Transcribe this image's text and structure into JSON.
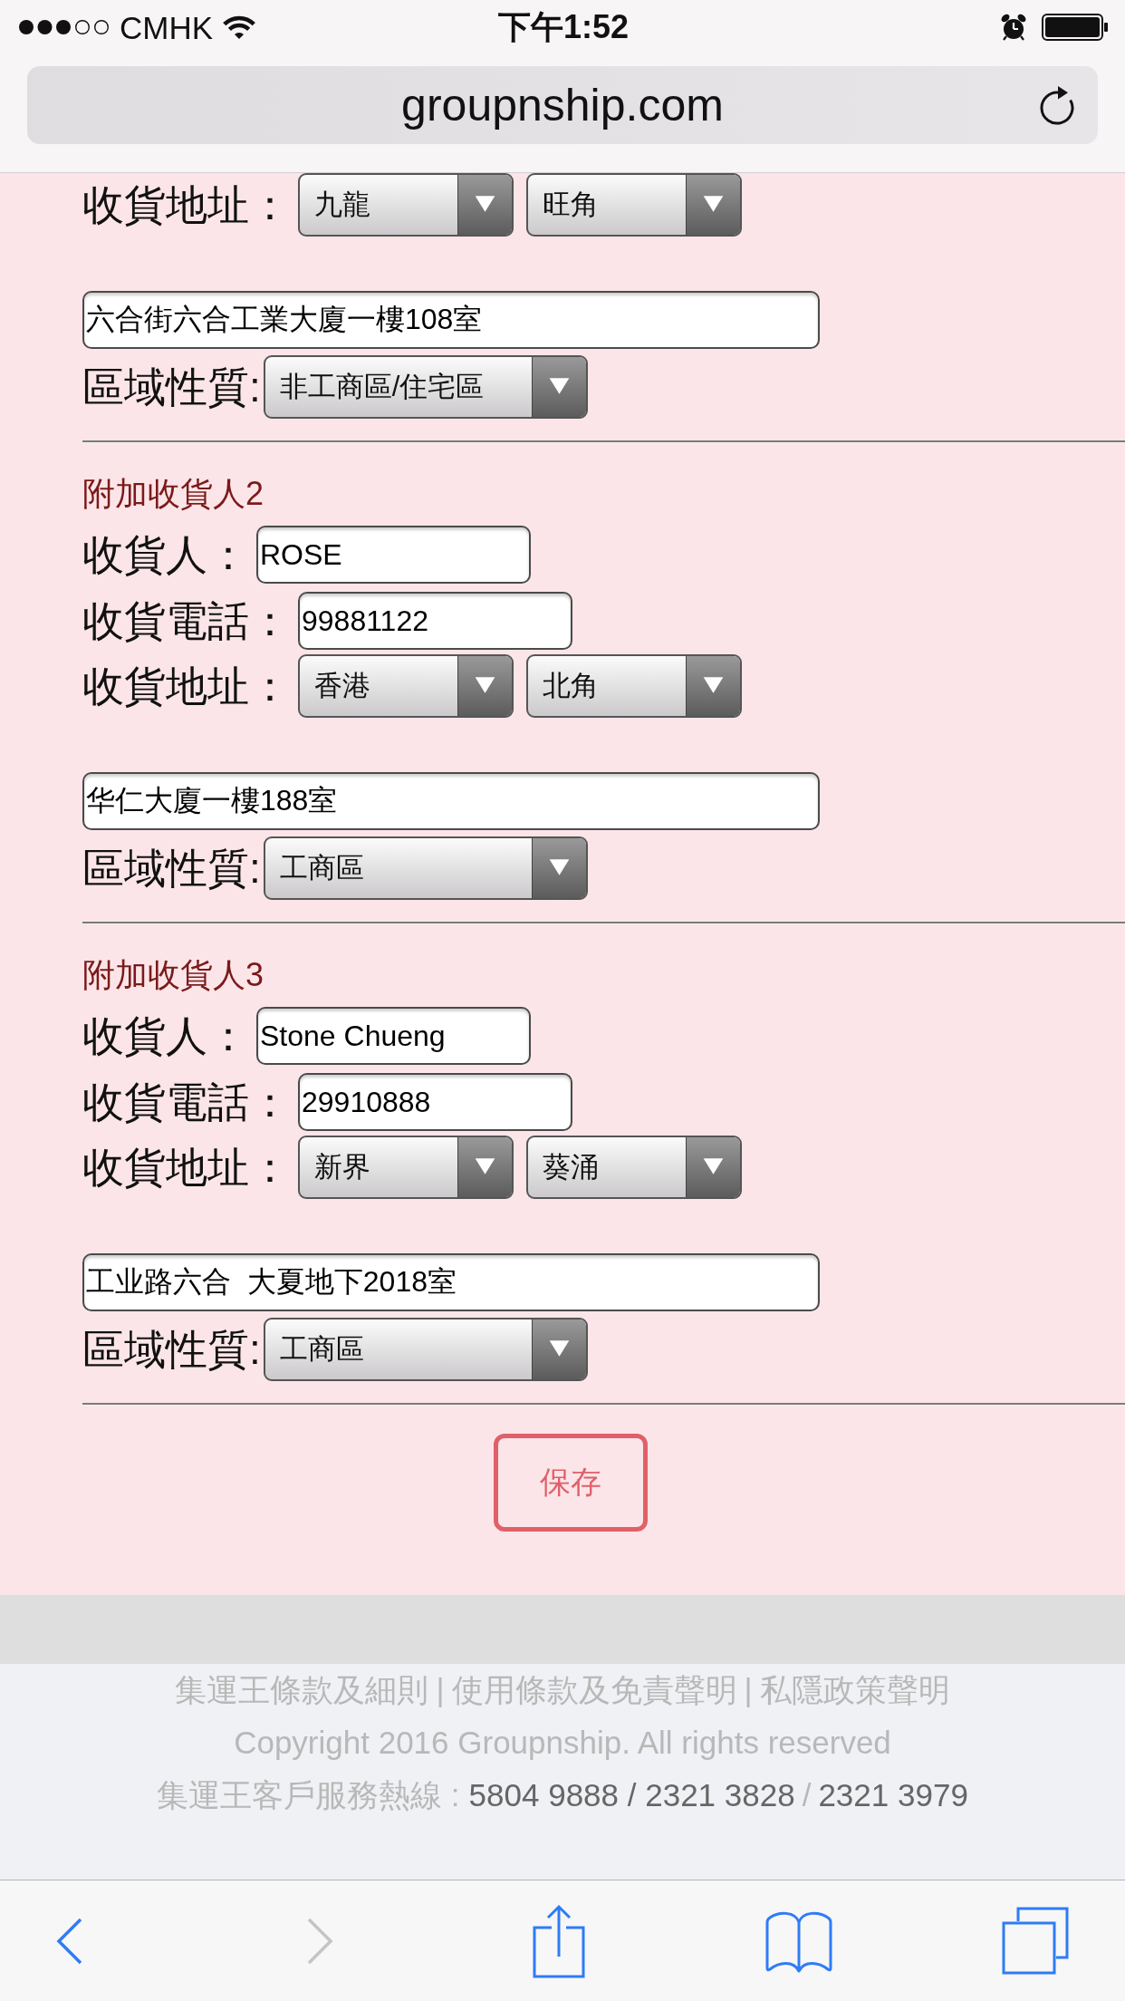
{
  "status_bar": {
    "carrier": "CMHK",
    "time": "下午1:52"
  },
  "address_bar": {
    "url": "groupnship.com"
  },
  "consignees": [
    {
      "address_label": "收貨地址：",
      "region": "九龍",
      "district": "旺角",
      "address": "六合街六合工業大廈一樓108室",
      "area_type_label": "區域性質:",
      "area_type": "非工商區/住宅區"
    },
    {
      "heading": "附加收貨人2",
      "name_label": "收貨人：",
      "name": "ROSE",
      "phone_label": "收貨電話：",
      "phone": "99881122",
      "address_label": "收貨地址：",
      "region": "香港",
      "district": "北角",
      "address": "华仁大廈一樓188室",
      "area_type_label": "區域性質:",
      "area_type": "工商區"
    },
    {
      "heading": "附加收貨人3",
      "name_label": "收貨人：",
      "name": "Stone Chueng",
      "phone_label": "收貨電話：",
      "phone": "29910888",
      "address_label": "收貨地址：",
      "region": "新界",
      "district": "葵涌",
      "address": "工业路六合  大夏地下2018室",
      "area_type_label": "區域性質:",
      "area_type": "工商區"
    }
  ],
  "save_button": "保存",
  "footer": {
    "policy_links": [
      "集運王條款及細則",
      "使用條款及免責聲明",
      "私隱政策聲明"
    ],
    "policy_separators": [
      "|",
      "|"
    ],
    "copyright": "Copyright 2016 Groupnship. All rights reserved",
    "hotline_line": [
      {
        "kind": "label",
        "text": "集運王客戶服務熱線 :"
      },
      {
        "kind": "phone",
        "text": "5804 9888 / 2321 3828"
      },
      {
        "kind": "separator",
        "text": "/"
      },
      {
        "kind": "phone",
        "text": "2321 3979"
      }
    ]
  },
  "toolbar": [
    {
      "kind": "back",
      "disabled": false
    },
    {
      "kind": "forward",
      "disabled": true
    },
    {
      "kind": "share",
      "disabled": false
    },
    {
      "kind": "bookmarks",
      "disabled": false
    },
    {
      "kind": "tabs",
      "disabled": false
    }
  ]
}
